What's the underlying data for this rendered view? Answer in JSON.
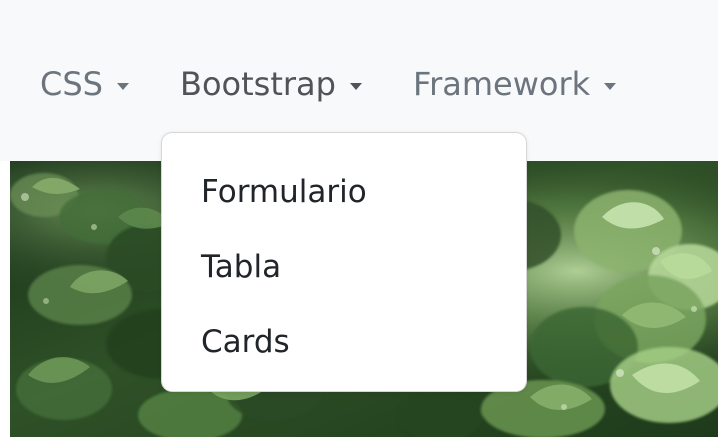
{
  "navbar": {
    "items": [
      {
        "label": "CSS"
      },
      {
        "label": "Bootstrap"
      },
      {
        "label": "Framework"
      }
    ]
  },
  "dropdown": {
    "items": [
      {
        "label": "Formulario"
      },
      {
        "label": "Tabla"
      },
      {
        "label": "Cards"
      }
    ]
  },
  "colors": {
    "navbar_background": "#f8f9fa",
    "nav_text": "#6c757d",
    "dropdown_text": "#212529",
    "dropdown_border": "#d9dcdf"
  },
  "icons": {
    "caret": "caret-down-icon"
  }
}
